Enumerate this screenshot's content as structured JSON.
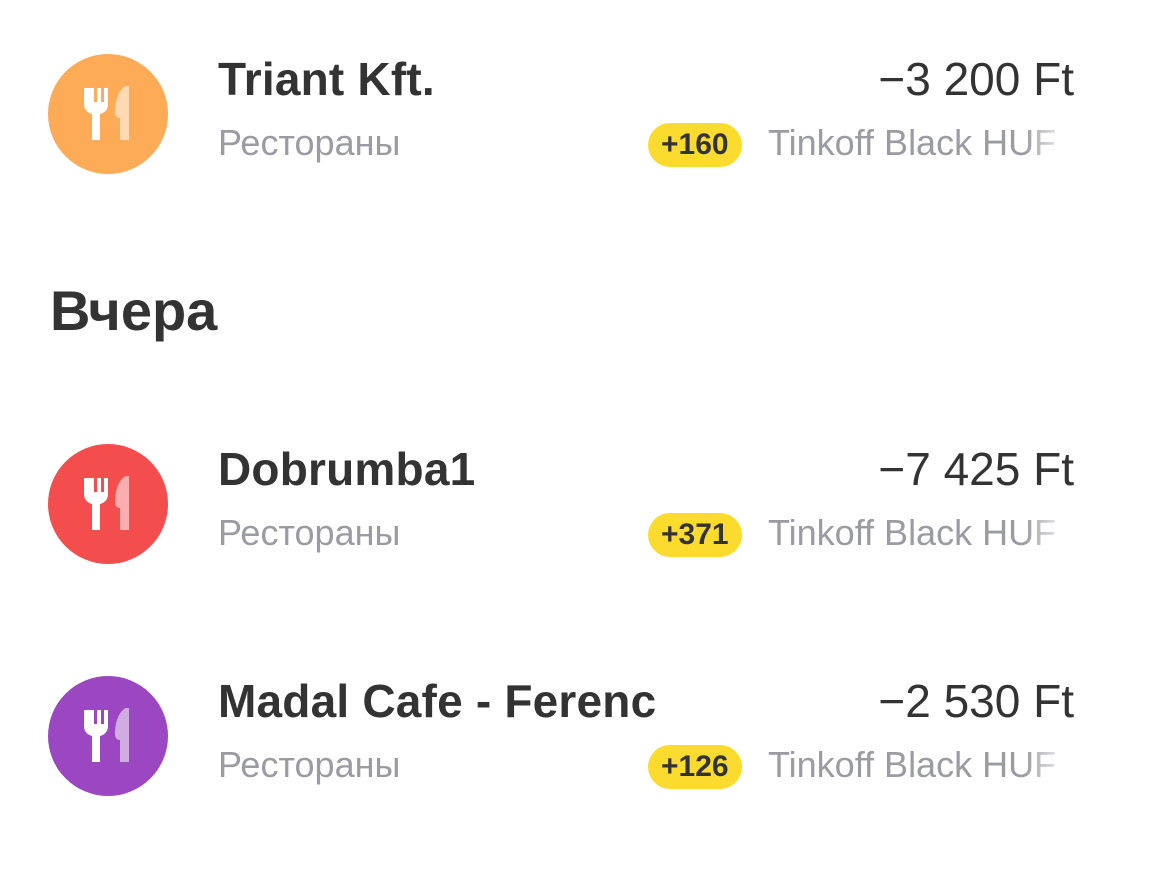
{
  "transactions_top": [
    {
      "merchant": "Triant Kft.",
      "category": "Рестораны",
      "amount": "−3 200 Ft",
      "bonus": "+160",
      "account": "Tinkoff Black HUF",
      "icon": "fork-knife-icon",
      "icon_color": "#fdab56"
    }
  ],
  "sections": [
    {
      "title": "Вчера",
      "transactions": [
        {
          "merchant": "Dobrumba1",
          "category": "Рестораны",
          "amount": "−7 425 Ft",
          "bonus": "+371",
          "account": "Tinkoff Black HUF",
          "icon": "fork-knife-icon",
          "icon_color": "#f44d4e"
        },
        {
          "merchant": "Madal Cafe - Ferenc",
          "category": "Рестораны",
          "amount": "−2 530 Ft",
          "bonus": "+126",
          "account": "Tinkoff Black HUF",
          "icon": "fork-knife-icon",
          "icon_color": "#9a47c1"
        }
      ]
    }
  ],
  "colors": {
    "bonus_badge": "#fbdc2e",
    "primary_text": "#333333",
    "secondary_text": "#9b9ba3"
  }
}
